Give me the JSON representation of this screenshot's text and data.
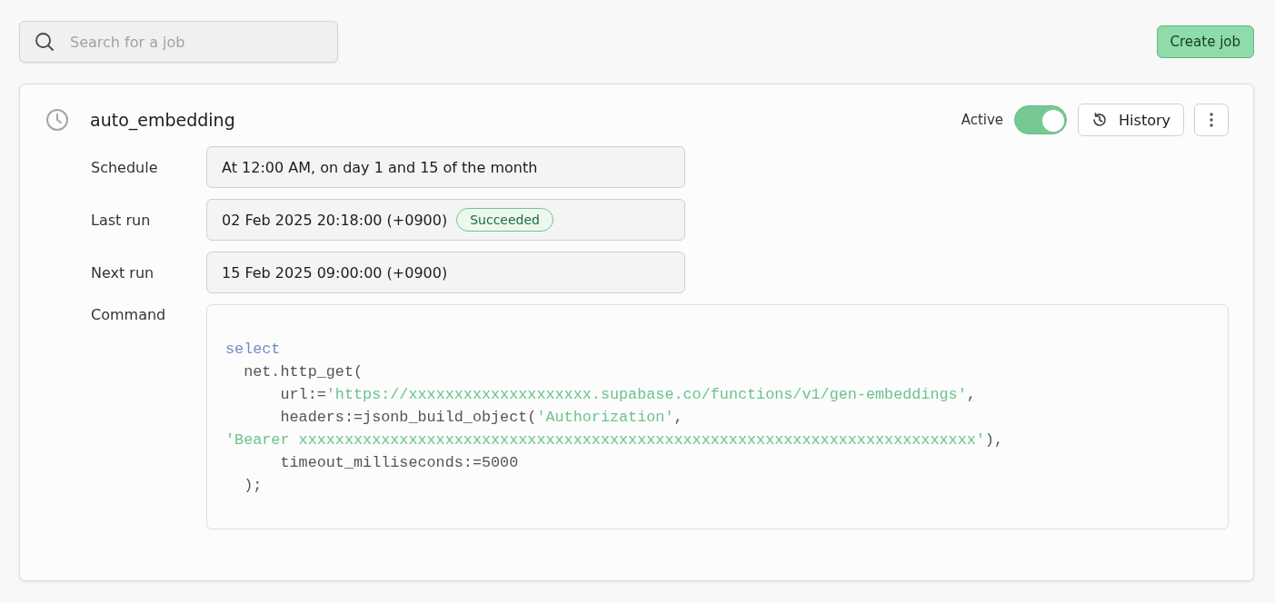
{
  "search": {
    "placeholder": "Search for a job"
  },
  "create_button": "Create job",
  "job": {
    "name": "auto_embedding",
    "active_label": "Active",
    "active": true,
    "history_button": "History",
    "fields": [
      {
        "label": "Schedule",
        "value": "At 12:00 AM, on day 1 and 15 of the month"
      },
      {
        "label": "Last run",
        "value": "02 Feb 2025 20:18:00 (+0900)",
        "status": "Succeeded"
      },
      {
        "label": "Next run",
        "value": "15 Feb 2025 09:00:00 (+0900)"
      }
    ],
    "command": {
      "label": "Command",
      "lines": [
        [
          {
            "kind": "keyword",
            "text": "select"
          }
        ],
        [
          {
            "kind": "plain",
            "text": "  net.http_get("
          }
        ],
        [
          {
            "kind": "plain",
            "text": "      url:="
          },
          {
            "kind": "string",
            "text": "'https://xxxxxxxxxxxxxxxxxxxx.supabase.co/functions/v1/gen-embeddings'"
          },
          {
            "kind": "plain",
            "text": ","
          }
        ],
        [
          {
            "kind": "plain",
            "text": "      headers:=jsonb_build_object("
          },
          {
            "kind": "string",
            "text": "'Authorization'"
          },
          {
            "kind": "plain",
            "text": ","
          }
        ],
        [
          {
            "kind": "string",
            "text": "'Bearer xxxxxxxxxxxxxxxxxxxxxxxxxxxxxxxxxxxxxxxxxxxxxxxxxxxxxxxxxxxxxxxxxxxxxxxxxx'"
          },
          {
            "kind": "plain",
            "text": "),"
          }
        ],
        [
          {
            "kind": "plain",
            "text": "      timeout_milliseconds:=5000"
          }
        ],
        [
          {
            "kind": "plain",
            "text": "  );"
          }
        ]
      ]
    }
  }
}
